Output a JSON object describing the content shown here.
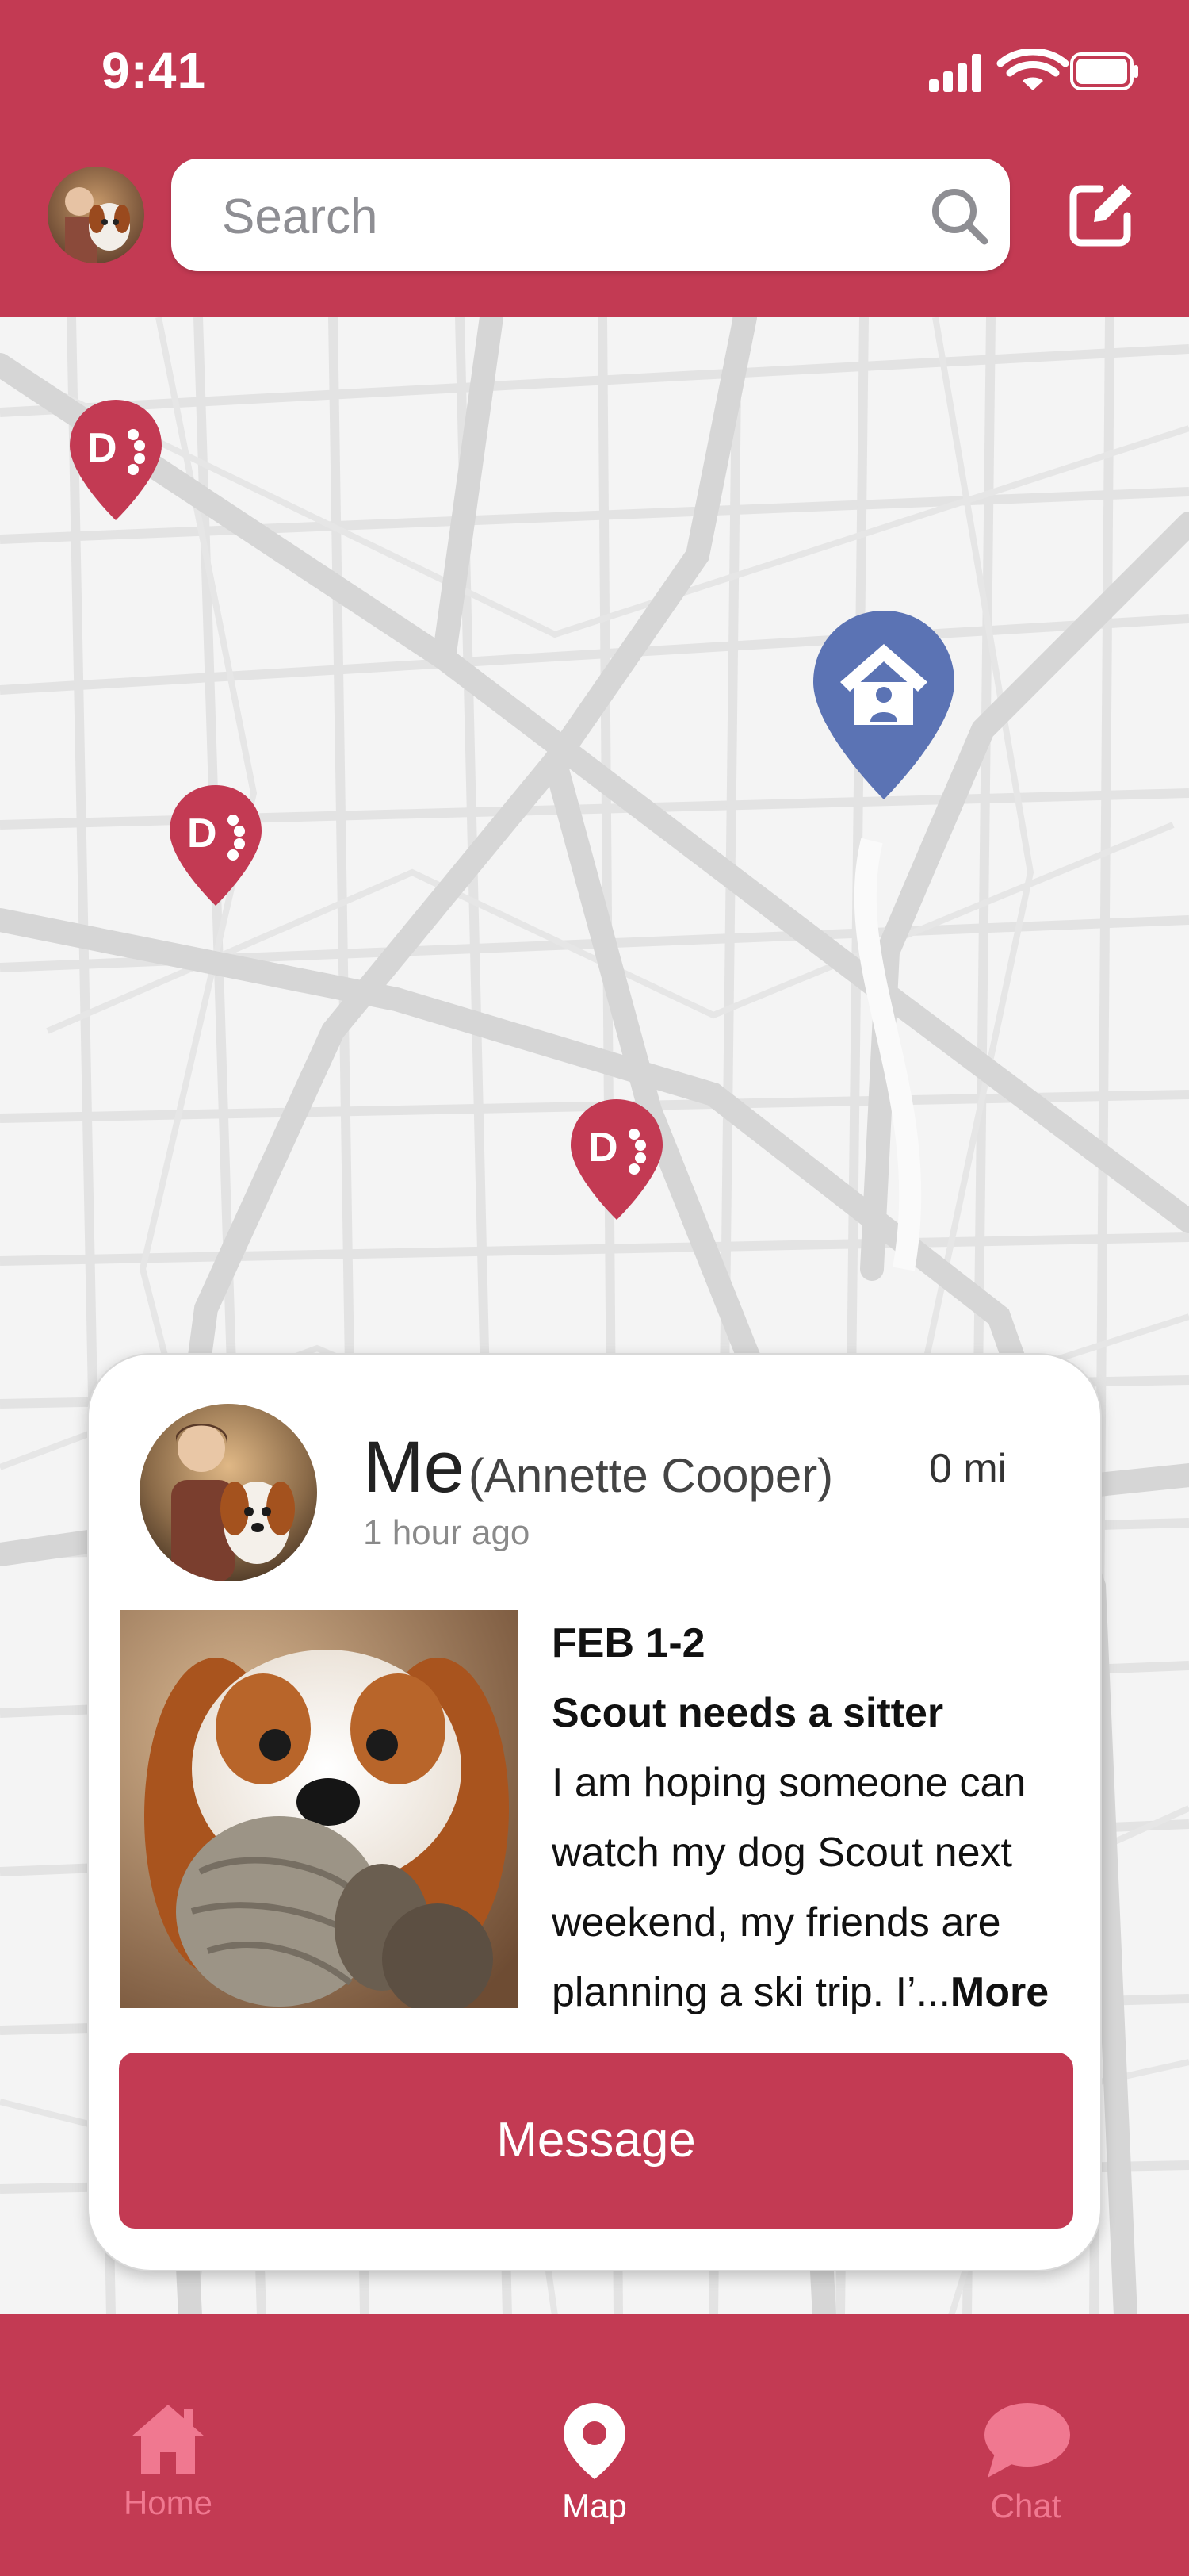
{
  "status": {
    "time": "9:41"
  },
  "search": {
    "placeholder": "Search"
  },
  "post": {
    "name": "Me",
    "full_name": "(Annette Cooper)",
    "distance": "0 mi",
    "time_ago": "1 hour ago",
    "date": "FEB 1-2",
    "title": "Scout needs a sitter",
    "body": "I am hoping someone can watch my dog Scout next weekend, my friends are planning a ski trip. I’...",
    "more": "More",
    "message_button": "Message"
  },
  "tabs": [
    {
      "label": "Home",
      "icon": "home-icon",
      "active": false
    },
    {
      "label": "Map",
      "icon": "map-pin-icon",
      "active": true
    },
    {
      "label": "Chat",
      "icon": "chat-bubble-icon",
      "active": false
    }
  ],
  "colors": {
    "brand": "#C33A53",
    "home_pin": "#5B73B4",
    "inactive_tab": "#F07890"
  }
}
